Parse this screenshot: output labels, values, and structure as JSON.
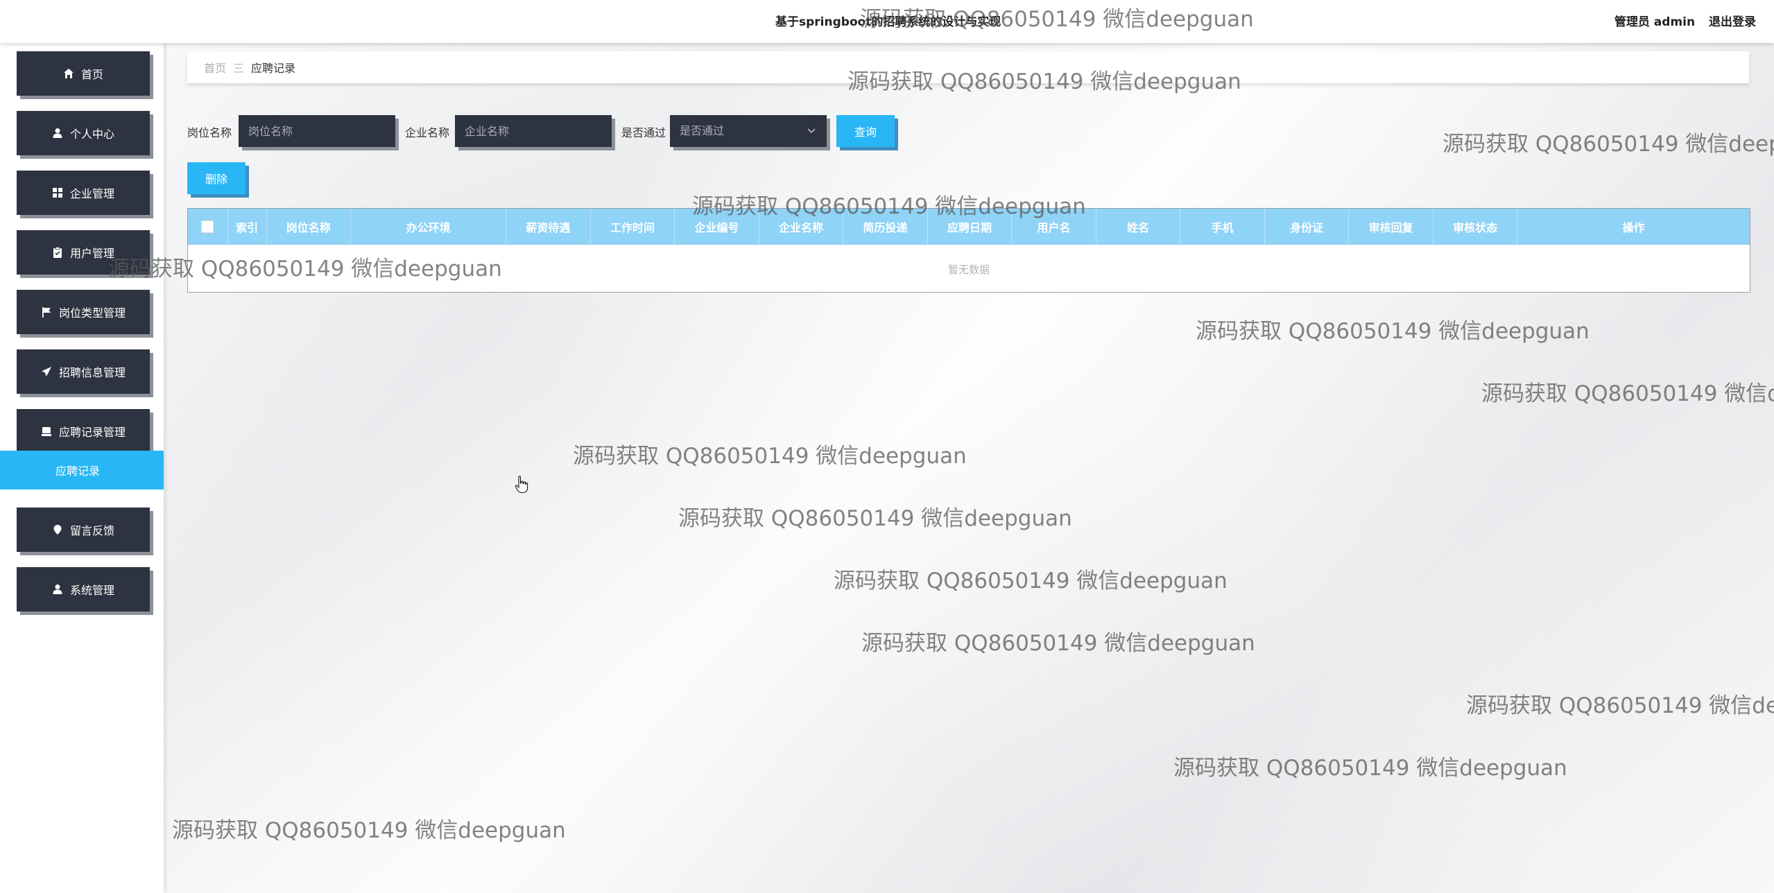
{
  "app": {
    "title": "基于springboot的招聘系统的设计与实现",
    "user_role": "管理员 admin",
    "logout": "退出登录"
  },
  "sidebar": {
    "items": [
      {
        "label": "首页",
        "icon": "home-icon"
      },
      {
        "label": "个人中心",
        "icon": "user-icon"
      },
      {
        "label": "企业管理",
        "icon": "grid-icon"
      },
      {
        "label": "用户管理",
        "icon": "clipboard-icon"
      },
      {
        "label": "岗位类型管理",
        "icon": "flag-icon"
      },
      {
        "label": "招聘信息管理",
        "icon": "send-icon"
      },
      {
        "label": "应聘记录管理",
        "icon": "box-icon"
      },
      {
        "label": "留言反馈",
        "icon": "pin-icon"
      },
      {
        "label": "系统管理",
        "icon": "user-icon"
      }
    ],
    "submenu": {
      "label": "应聘记录"
    }
  },
  "breadcrumb": {
    "home": "首页",
    "separator": "三",
    "current": "应聘记录"
  },
  "search": {
    "job_label": "岗位名称",
    "job_placeholder": "岗位名称",
    "company_label": "企业名称",
    "company_placeholder": "企业名称",
    "passed_label": "是否通过",
    "passed_value": "是否通过",
    "query_button": "查询"
  },
  "actions": {
    "delete_button": "删除"
  },
  "table": {
    "columns": [
      "索引",
      "岗位名称",
      "办公环境",
      "薪资待遇",
      "工作时间",
      "企业编号",
      "企业名称",
      "简历投递",
      "应聘日期",
      "用户名",
      "姓名",
      "手机",
      "身份证",
      "审核回复",
      "审核状态",
      "操作"
    ],
    "empty_text": "暂无数据"
  },
  "watermark": "源码获取 QQ86050149 微信deepguan",
  "colors": {
    "menu_bg": "#2d3340",
    "accent": "#29b6f6",
    "table_header": "#8fd3f7"
  }
}
